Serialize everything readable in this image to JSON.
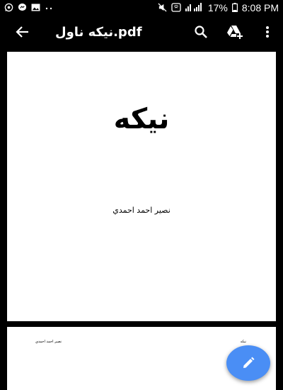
{
  "statusbar": {
    "left_icons": [
      "whatsapp-icon",
      "messenger-icon",
      "image-icon",
      "dots-icon"
    ],
    "right_icons": [
      "mute-icon",
      "wifi-call-icon",
      "signal-icon",
      "battery-icon"
    ],
    "battery_percent": "17%",
    "time": "8:08 PM"
  },
  "toolbar": {
    "title": "نیکه ناول.pdf",
    "icons": [
      "back-arrow-icon",
      "search-icon",
      "drive-add-icon",
      "more-vert-icon"
    ]
  },
  "document": {
    "page1": {
      "title": "نیکه",
      "author": "نصیر احمد احمدي"
    },
    "page2": {
      "header_left": "نصیر احمد احمدي",
      "header_right": "نیکه"
    }
  },
  "fab": {
    "icon": "edit-pencil-icon",
    "color": "#4a8ef5"
  }
}
